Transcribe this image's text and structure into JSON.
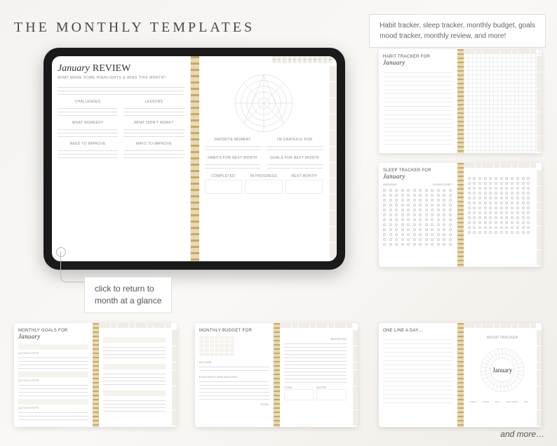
{
  "page_title": "THE MONTHLY TEMPLATES",
  "subtitle_line1": "Habit tracker, sleep tracker, monthly budget, goals",
  "subtitle_line2": "mood tracker, monthly review, and more!",
  "main_preview": {
    "title_script": "January",
    "title_rest": "REVIEW",
    "prompt": "WHAT WERE SOME HIGHLIGHTS & WINS THIS MONTH?",
    "left_sections": {
      "challenges": "CHALLENGES",
      "lessons": "LESSONS",
      "worked": "WHAT WORKED?",
      "didnt_work": "WHAT DIDN'T WORK?",
      "need_improve": "NEED TO IMPROVE",
      "ways_improve": "WAYS TO IMPROVE"
    },
    "right_sections": {
      "favorite": "FAVORITE MOMENT",
      "grateful": "I'M GRATEFUL FOR",
      "habits": "HABITS FOR NEXT MONTH",
      "goals": "GOALS FOR NEXT MONTH",
      "completed": "COMPLETED",
      "in_progress": "IN PROGRESS",
      "next_month": "NEXT MONTH"
    },
    "top_tabs": [
      "H",
      "1",
      "2",
      "3",
      "4",
      "5",
      "6",
      "Q",
      "M",
      "F",
      "T",
      "W"
    ],
    "side_tabs": [
      "JAN",
      "FEB",
      "MAR",
      "APR",
      "MAY",
      "JUN",
      "JUL",
      "AUG",
      "SEP",
      "OCT",
      "NOV",
      "DEC"
    ]
  },
  "callout": {
    "line1": "click to return to",
    "line2": "month at a glance"
  },
  "thumbs": {
    "habit": {
      "title_prefix": "HABIT TRACKER FOR",
      "script": "January"
    },
    "sleep": {
      "title_prefix": "SLEEP TRACKER FOR",
      "script": "January",
      "col1": "WEEKDAY",
      "col2": "HOURS SLEPT"
    },
    "goals": {
      "title_prefix": "MONTHLY GOALS FOR",
      "script": "January",
      "steps": "ACTION STEPS"
    },
    "budget": {
      "title_prefix": "MONTHLY BUDGET FOR",
      "income": "INCOME",
      "expenses": "EXPENSES BREAKDOWN",
      "total": "TOTAL",
      "budget_label": "BUDGETED",
      "notes": "NOTES"
    },
    "line_mood": {
      "left_title": "ONE LINE A DAY…",
      "right_title": "MOOD TRACKER",
      "center": "January",
      "moods": [
        "GREAT",
        "GOOD",
        "OKAY",
        "NOT GREAT",
        "BAD"
      ]
    }
  },
  "and_more": "and more…"
}
